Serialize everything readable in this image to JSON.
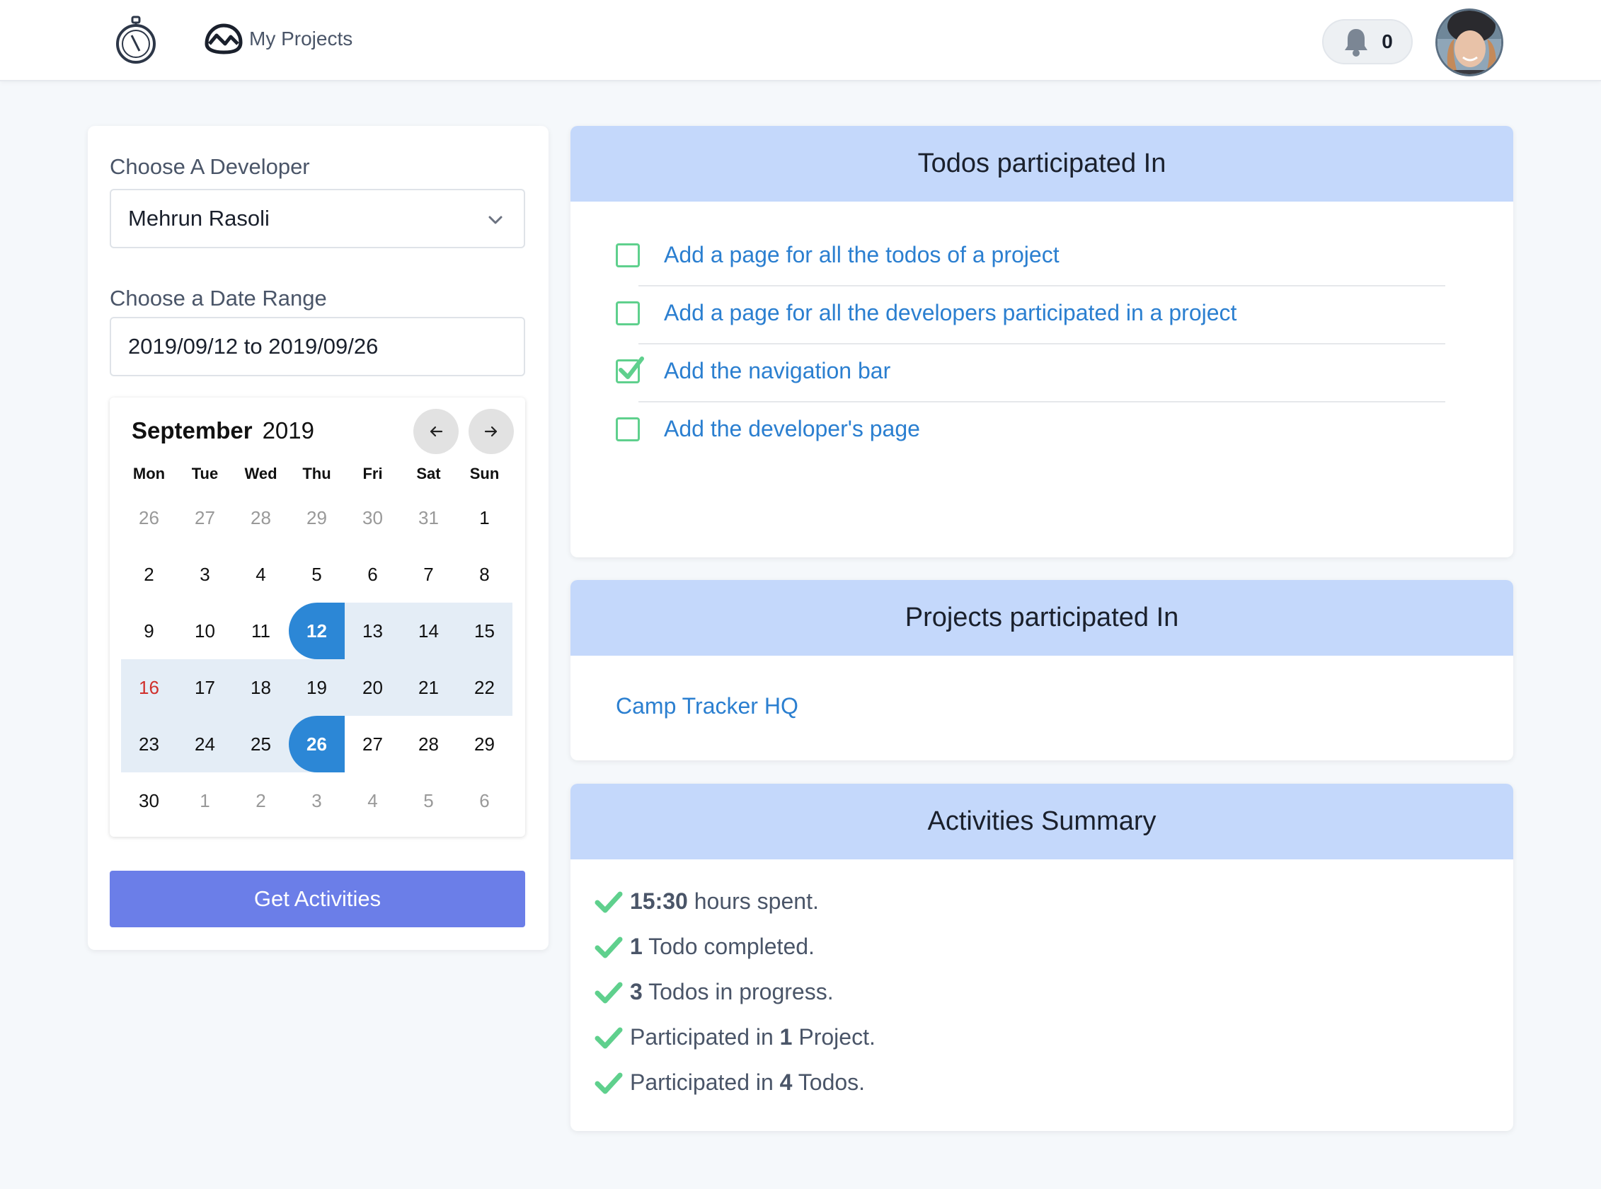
{
  "navbar": {
    "logo_icon": "stopwatch-icon",
    "nav_link_label": "My Projects",
    "notifications_count": "0"
  },
  "filters": {
    "developer_label": "Choose A Developer",
    "developer_selected": "Mehrun Rasoli",
    "date_range_label": "Choose a Date Range",
    "date_range_value": "2019/09/12 to 2019/09/26",
    "button_label": "Get Activities"
  },
  "calendar": {
    "month": "September",
    "year": "2019",
    "weekdays": [
      "Mon",
      "Tue",
      "Wed",
      "Thu",
      "Fri",
      "Sat",
      "Sun"
    ],
    "days": [
      "26",
      "27",
      "28",
      "29",
      "30",
      "31",
      "1",
      "2",
      "3",
      "4",
      "5",
      "6",
      "7",
      "8",
      "9",
      "10",
      "11",
      "12",
      "13",
      "14",
      "15",
      "16",
      "17",
      "18",
      "19",
      "20",
      "21",
      "22",
      "23",
      "24",
      "25",
      "26",
      "27",
      "28",
      "29",
      "30",
      "1",
      "2",
      "3",
      "4",
      "5",
      "6"
    ],
    "range_start": "12",
    "range_end": "26"
  },
  "todos": {
    "title": "Todos participated In",
    "items": [
      {
        "label": "Add a page for all the todos of a project",
        "done": false
      },
      {
        "label": "Add a page for all the developers participated in a project",
        "done": false
      },
      {
        "label": "Add the navigation bar",
        "done": true
      },
      {
        "label": "Add the developer's page",
        "done": false
      }
    ]
  },
  "projects": {
    "title": "Projects participated In",
    "items": [
      "Camp Tracker HQ"
    ]
  },
  "summary": {
    "title": "Activities Summary",
    "items": [
      {
        "before": "",
        "value": "15:30",
        "after": " hours spent."
      },
      {
        "before": "",
        "value": "1",
        "after": " Todo completed."
      },
      {
        "before": "",
        "value": "3",
        "after": " Todos in progress."
      },
      {
        "before": "Participated in ",
        "value": "1",
        "after": " Project."
      },
      {
        "before": "Participated in ",
        "value": "4",
        "after": " Todos."
      }
    ]
  },
  "colors": {
    "accent": "#2c87d6",
    "button": "#6b7ee8",
    "header_bg": "#c4d8fb",
    "check_green": "#5fd08d",
    "link": "#2b7fd0"
  }
}
